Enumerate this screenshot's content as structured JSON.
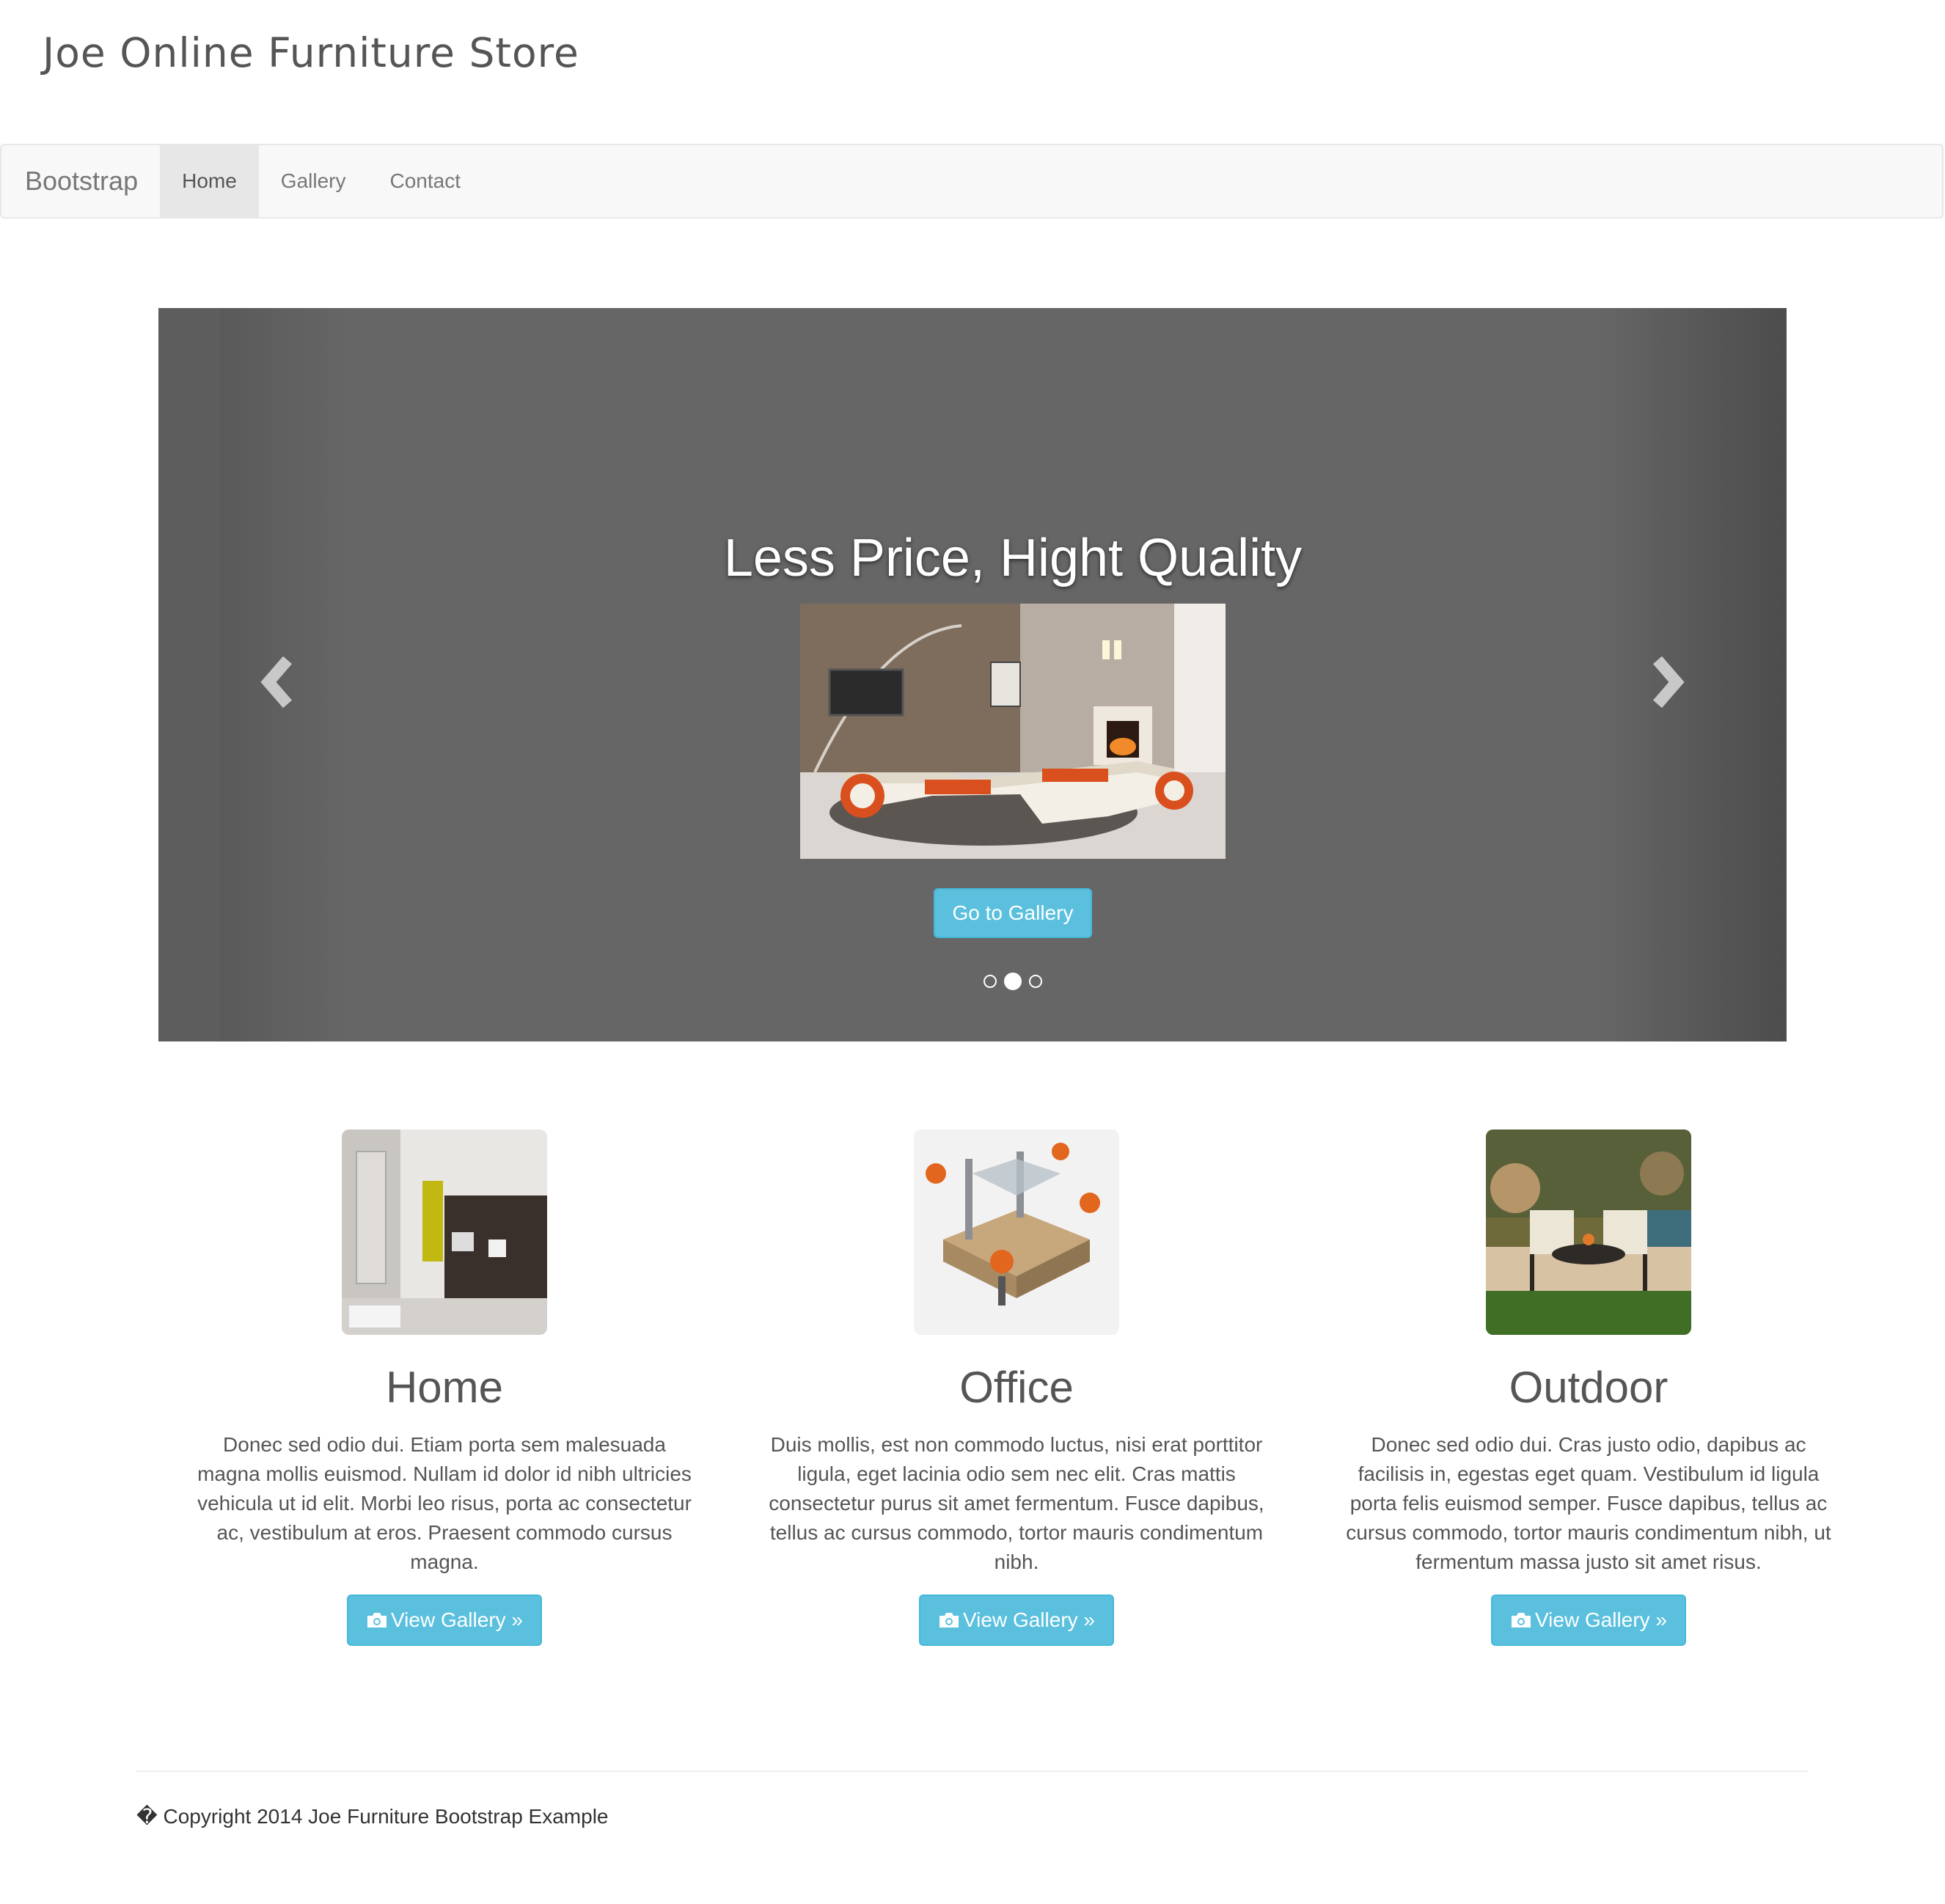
{
  "site": {
    "title": "Joe Online Furniture Store"
  },
  "navbar": {
    "brand": "Bootstrap",
    "items": [
      {
        "label": "Home",
        "active": true
      },
      {
        "label": "Gallery",
        "active": false
      },
      {
        "label": "Contact",
        "active": false
      }
    ]
  },
  "carousel": {
    "heading": "Less Price, Hight Quality",
    "button_label": "Go to Gallery",
    "slide_count": 3,
    "active_slide": 2,
    "prev_icon": "chevron-left-icon",
    "next_icon": "chevron-right-icon"
  },
  "features": [
    {
      "title": "Home",
      "text": "Donec sed odio dui. Etiam porta sem malesuada magna mollis euismod. Nullam id dolor id nibh ultricies vehicula ut id elit. Morbi leo risus, porta ac consectetur ac, vestibulum at eros. Praesent commodo cursus magna.",
      "button_label": "View Gallery »"
    },
    {
      "title": "Office",
      "text": "Duis mollis, est non commodo luctus, nisi erat porttitor ligula, eget lacinia odio sem nec elit. Cras mattis consectetur purus sit amet fermentum. Fusce dapibus, tellus ac cursus commodo, tortor mauris condimentum nibh.",
      "button_label": "View Gallery »"
    },
    {
      "title": "Outdoor",
      "text": "Donec sed odio dui. Cras justo odio, dapibus ac facilisis in, egestas eget quam. Vestibulum id ligula porta felis euismod semper. Fusce dapibus, tellus ac cursus commodo, tortor mauris condimentum nibh, ut fermentum massa justo sit amet risus.",
      "button_label": "View Gallery »"
    }
  ],
  "footer": {
    "text": "� Copyright 2014 Joe Furniture Bootstrap Example"
  },
  "colors": {
    "info_button": "#5bc0de",
    "navbar_bg": "#f8f8f8",
    "carousel_bg": "#666666"
  }
}
